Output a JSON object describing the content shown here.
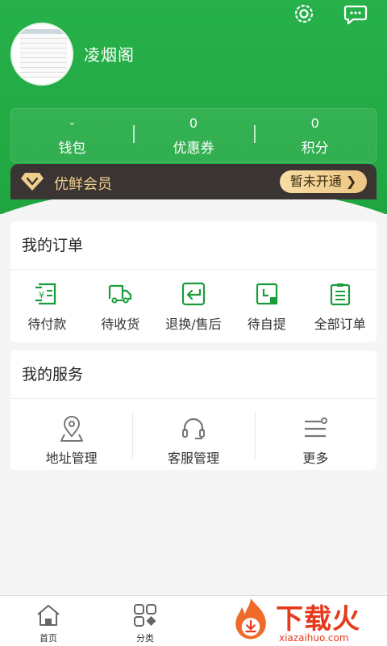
{
  "profile": {
    "username": "凌烟阁"
  },
  "stats": [
    {
      "value": "-",
      "label": "钱包"
    },
    {
      "value": "0",
      "label": "优惠券"
    },
    {
      "value": "0",
      "label": "积分"
    }
  ],
  "vip": {
    "label": "优鲜会员",
    "button": "暂未开通 ❯"
  },
  "orders": {
    "title": "我的订单",
    "items": [
      {
        "label": "待付款",
        "icon": "payment-pending-icon"
      },
      {
        "label": "待收货",
        "icon": "delivery-truck-icon"
      },
      {
        "label": "退换/售后",
        "icon": "return-exchange-icon"
      },
      {
        "label": "待自提",
        "icon": "pickup-icon"
      },
      {
        "label": "全部订单",
        "icon": "all-orders-icon"
      }
    ]
  },
  "services": {
    "title": "我的服务",
    "items": [
      {
        "label": "地址管理",
        "icon": "location-pin-icon"
      },
      {
        "label": "客服管理",
        "icon": "headset-icon"
      },
      {
        "label": "更多",
        "icon": "more-icon"
      }
    ]
  },
  "tabbar": {
    "items": [
      {
        "label": "首页",
        "icon": "home-icon"
      },
      {
        "label": "分类",
        "icon": "category-icon"
      }
    ]
  },
  "watermark": {
    "text": "下载火",
    "url": "xiazaihuo.com"
  },
  "colors": {
    "brand_green": "#1fa640",
    "icon_green": "#1a9c3a",
    "vip_bg": "#3a3433",
    "vip_gold": "#f0cf8e"
  }
}
